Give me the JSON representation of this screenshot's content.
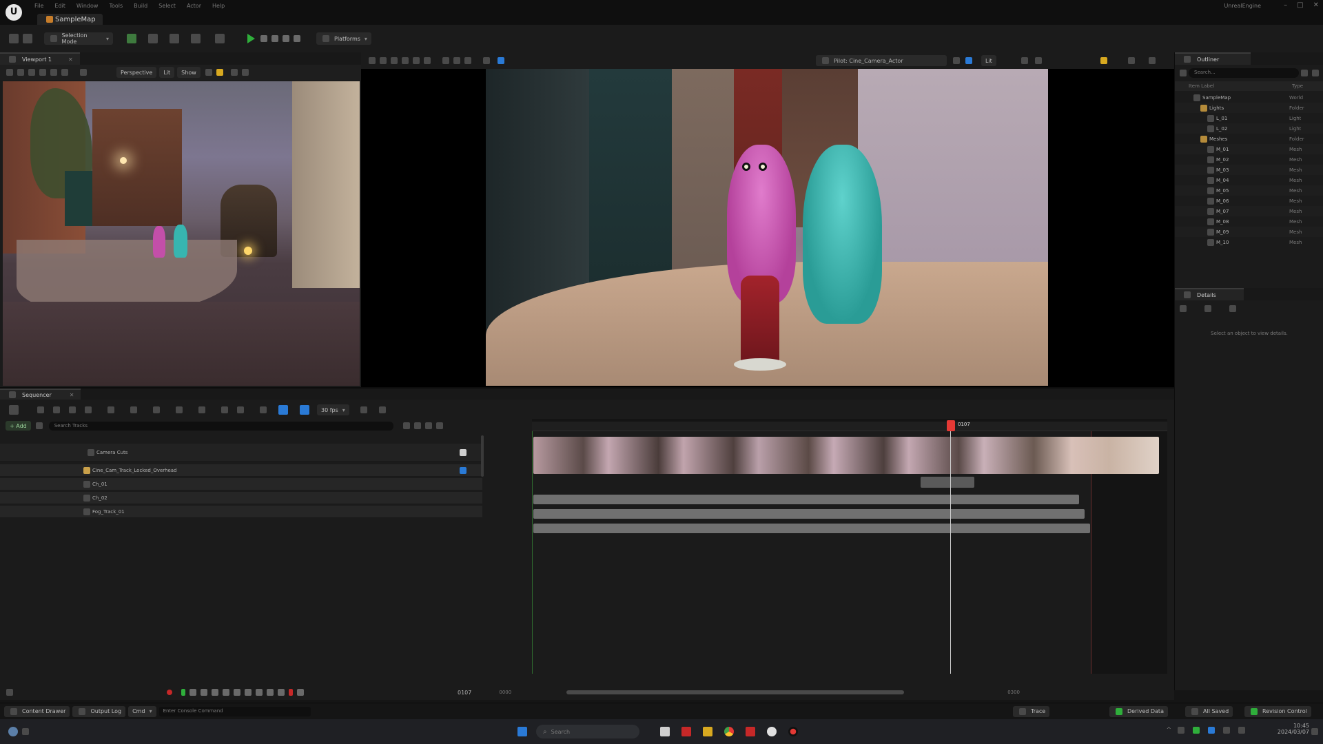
{
  "app": {
    "window_title": "UnrealEngine",
    "project_tab": "SampleMap",
    "menu": [
      "File",
      "Edit",
      "Window",
      "Tools",
      "Build",
      "Select",
      "Actor",
      "Help"
    ]
  },
  "toolbar": {
    "mode_label": "Selection Mode",
    "platforms_label": "Platforms"
  },
  "viewport_left": {
    "tab": "Viewport 1",
    "perspective_label": "Perspective",
    "lit_label": "Lit",
    "show_label": "Show"
  },
  "viewport_right": {
    "camera_label": "Pilot: Cine_Camera_Actor",
    "view_label": "Lit"
  },
  "outliner": {
    "tab": "Outliner",
    "search_placeholder": "Search...",
    "col_label": "Item Label",
    "col_type": "Type",
    "items": [
      "SampleMap",
      "Lights",
      "L_01",
      "L_02",
      "Meshes",
      "M_01",
      "M_02",
      "M_03",
      "M_04",
      "M_05",
      "M_06",
      "M_07",
      "M_08",
      "M_09",
      "M_10"
    ],
    "types": [
      "World",
      "Folder",
      "Light",
      "Light",
      "Folder",
      "Mesh",
      "Mesh",
      "Mesh",
      "Mesh",
      "Mesh",
      "Mesh",
      "Mesh",
      "Mesh",
      "Mesh",
      "Mesh"
    ]
  },
  "details": {
    "tab": "Details",
    "empty_text": "Select an object to view details."
  },
  "sequencer": {
    "tab": "Sequencer",
    "fps_label": "30 fps",
    "add_label": "+ Add",
    "search_placeholder": "Search Tracks",
    "tracks": [
      "Camera Cuts",
      "Cine_Cam_Track_Locked_Overhead",
      "Ch_01",
      "Ch_02",
      "Fog_Track_01"
    ],
    "playhead_label": "0107",
    "frame_display": "0107",
    "start_frame": "0000",
    "end_frame": "0300"
  },
  "statusbar": {
    "content_drawer": "Content Drawer",
    "output_log": "Output Log",
    "cmd": "Cmd",
    "cmd_placeholder": "Enter Console Command",
    "trace": "Trace",
    "derived_data": "Derived Data",
    "all_saved": "All Saved",
    "revision_control": "Revision Control"
  },
  "taskbar": {
    "search_placeholder": "Search",
    "time": "10:45",
    "date": "2024/03/07"
  },
  "colors": {
    "accent_blue": "#2a7ad6",
    "play_green": "#2fae3b",
    "playhead_red": "#e53935",
    "panel_bg": "#151515"
  }
}
